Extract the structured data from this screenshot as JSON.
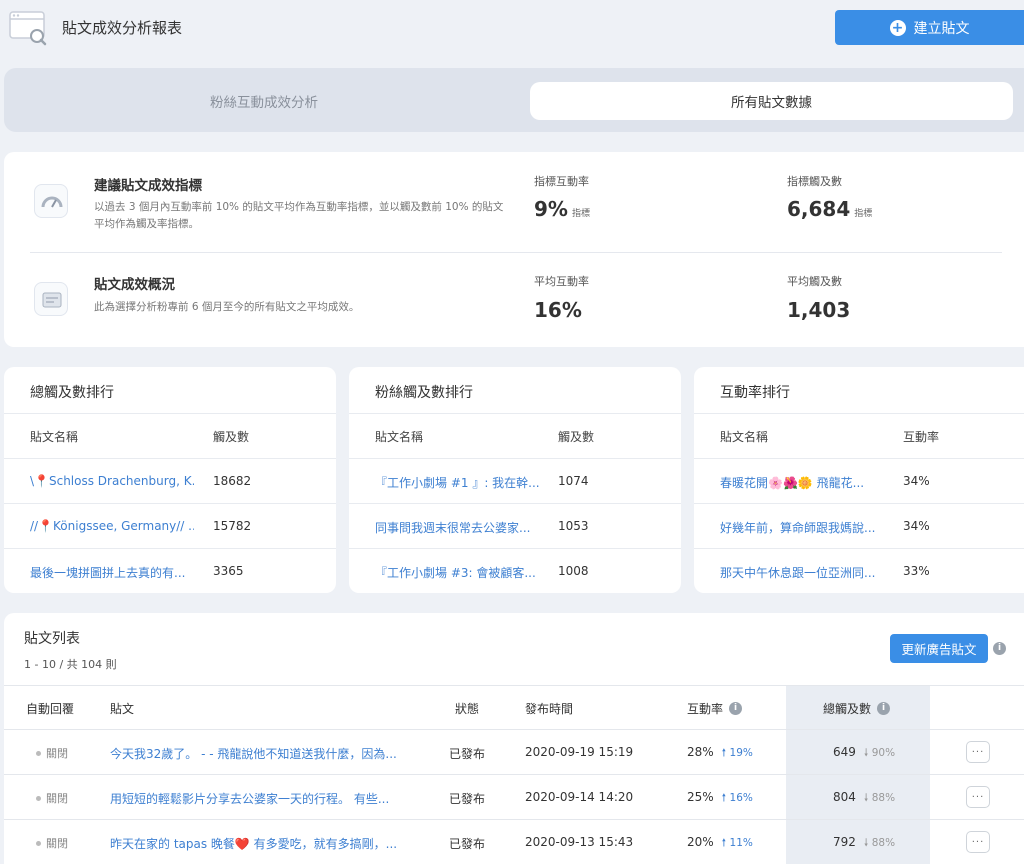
{
  "header": {
    "title": "貼文成效分析報表",
    "create_button": "建立貼文"
  },
  "tabs": [
    {
      "label": "粉絲互動成效分析",
      "active": false
    },
    {
      "label": "所有貼文數據",
      "active": true
    }
  ],
  "metrics": {
    "suggested": {
      "title": "建議貼文成效指標",
      "desc": "以過去 3 個月內互動率前 10% 的貼文平均作為互動率指標，並以觸及數前 10% 的貼文平均作為觸及率指標。",
      "engagement_label": "指標互動率",
      "engagement_value": "9%",
      "engagement_unit": "指標",
      "reach_label": "指標觸及數",
      "reach_value": "6,684",
      "reach_unit": "指標"
    },
    "overview": {
      "title": "貼文成效概況",
      "desc": "此為選擇分析粉專前 6 個月至今的所有貼文之平均成效。",
      "engagement_label": "平均互動率",
      "engagement_value": "16%",
      "reach_label": "平均觸及數",
      "reach_value": "1,403"
    }
  },
  "rankings": [
    {
      "title": "總觸及數排行",
      "col1": "貼文名稱",
      "col2": "觸及數",
      "rows": [
        {
          "name": "\\📍Schloss Drachenburg, K...",
          "value": "18682"
        },
        {
          "name": "//📍Königssee, Germany// ...",
          "value": "15782"
        },
        {
          "name": "最後一塊拼圖拼上去真的有...",
          "value": "3365"
        }
      ]
    },
    {
      "title": "粉絲觸及數排行",
      "col1": "貼文名稱",
      "col2": "觸及數",
      "rows": [
        {
          "name": "『工作小劇場 #1 』: 我在幹...",
          "value": "1074"
        },
        {
          "name": "同事問我週末很常去公婆家...",
          "value": "1053"
        },
        {
          "name": "『工作小劇場 #3: 會被顧客...",
          "value": "1008"
        }
      ]
    },
    {
      "title": "互動率排行",
      "col1": "貼文名稱",
      "col2": "互動率",
      "rows": [
        {
          "name": "春暖花開🌸🌺🌼 飛龍花...",
          "value": "34%"
        },
        {
          "name": "好幾年前，算命師跟我媽說...",
          "value": "34%"
        },
        {
          "name": "那天中午休息跟一位亞洲同...",
          "value": "33%"
        }
      ]
    }
  ],
  "posts": {
    "title": "貼文列表",
    "count": "1 - 10 / 共 104 則",
    "ad_button": "更新廣告貼文",
    "columns": {
      "auto_reply": "自動回覆",
      "post": "貼文",
      "status": "狀態",
      "published": "發布時間",
      "engagement": "互動率",
      "reach": "總觸及數"
    },
    "rows": [
      {
        "auto_reply": "關閉",
        "post": "今天我32歲了。 - - 飛龍說他不知道送我什麼，因為...",
        "status": "已發布",
        "published": "2020-09-19 15:19",
        "engagement": "28%",
        "engagement_trend": "19%",
        "reach": "649",
        "reach_trend": "90%"
      },
      {
        "auto_reply": "關閉",
        "post": "用短短的輕鬆影片分享去公婆家一天的行程。 有些...",
        "status": "已發布",
        "published": "2020-09-14 14:20",
        "engagement": "25%",
        "engagement_trend": "16%",
        "reach": "804",
        "reach_trend": "88%"
      },
      {
        "auto_reply": "關閉",
        "post": "昨天在家的 tapas 晚餐❤️ 有多愛吃，就有多搞剛，...",
        "status": "已發布",
        "published": "2020-09-13 15:43",
        "engagement": "20%",
        "engagement_trend": "11%",
        "reach": "792",
        "reach_trend": "88%"
      }
    ]
  }
}
